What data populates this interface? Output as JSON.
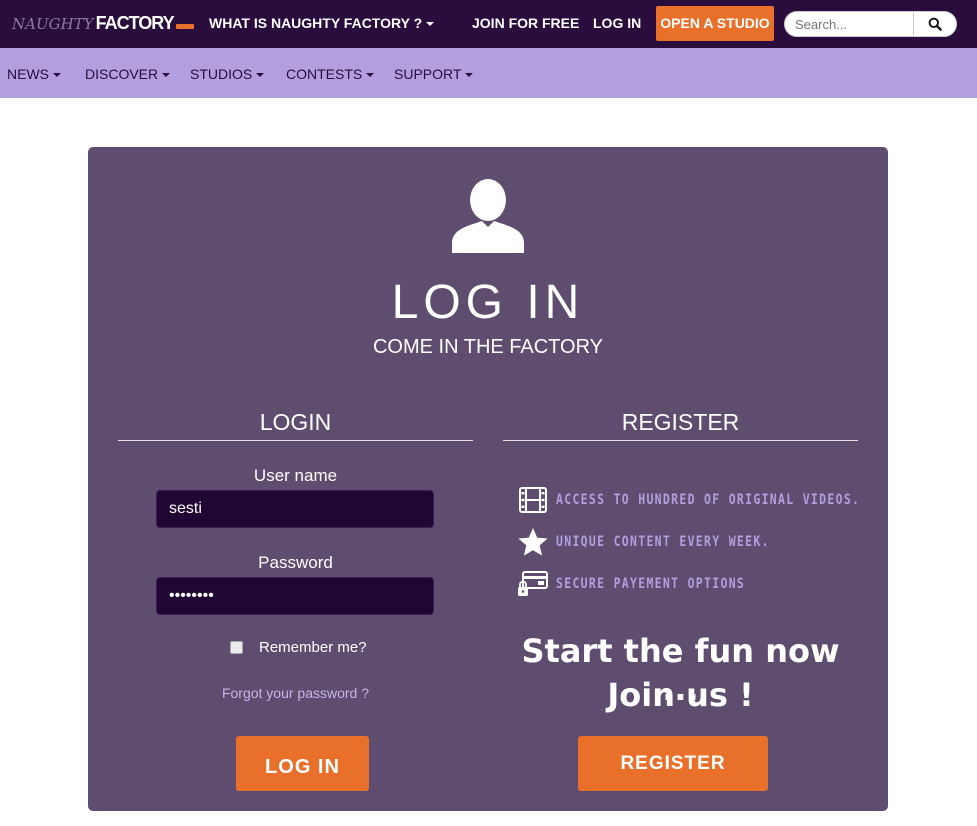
{
  "topbar": {
    "logo": {
      "part1": "NAUGHTY",
      "part2": "FACTORY"
    },
    "what_is": "WHAT IS NAUGHTY FACTORY ?",
    "join": "JOIN FOR FREE",
    "login": "LOG IN",
    "open_studio": "OPEN A STUDIO",
    "search_placeholder": "Search...",
    "search_icon": "search-icon"
  },
  "subnav": {
    "items": [
      {
        "label": "NEWS"
      },
      {
        "label": "DISCOVER"
      },
      {
        "label": "STUDIOS"
      },
      {
        "label": "CONTESTS"
      },
      {
        "label": "SUPPORT"
      }
    ]
  },
  "panel": {
    "icon": "user-icon",
    "title": "LOG IN",
    "subtitle": "COME IN THE FACTORY",
    "login": {
      "heading": "LOGIN",
      "username_label": "User name",
      "username_value": "sesti",
      "password_label": "Password",
      "password_value": "••••••••",
      "remember_label": "Remember me?",
      "remember_checked": false,
      "forgot": "Forgot your password ?",
      "button": "LOG IN"
    },
    "register": {
      "heading": "REGISTER",
      "features": [
        {
          "icon": "film-icon",
          "text": "ACCESS TO HUNDRED OF ORIGINAL VIDEOS."
        },
        {
          "icon": "star-icon",
          "text": "UNIQUE CONTENT EVERY WEEK."
        },
        {
          "icon": "secure-card-icon",
          "text": "SECURE PAYEMENT OPTIONS"
        }
      ],
      "cta_line1": "Start the fun now ...",
      "cta_line2": "Join us !",
      "button": "REGISTER"
    }
  },
  "colors": {
    "topbar": "#2a0c3d",
    "subnav": "#b39ee0",
    "panel": "#5e4d6e",
    "accent": "#e8702a",
    "input_bg": "#1f0633"
  }
}
